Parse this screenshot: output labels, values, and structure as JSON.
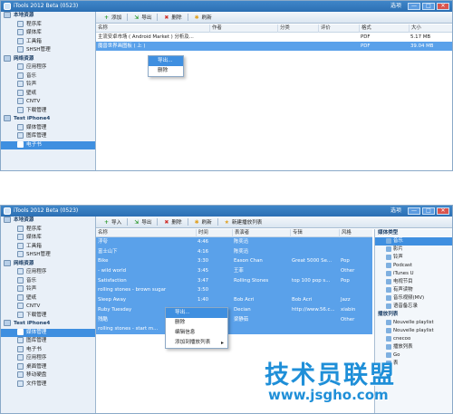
{
  "window1": {
    "title": "iTools 2012 Beta (0523)",
    "options": "选项",
    "window_buttons": [
      "—",
      "□",
      "✕"
    ],
    "sidebar": [
      {
        "type": "group",
        "label": "本地资源",
        "icon": "computer-icon"
      },
      {
        "type": "item",
        "label": "程序库",
        "icon": "app-library-icon"
      },
      {
        "type": "item",
        "label": "媒体库",
        "icon": "media-library-icon"
      },
      {
        "type": "item",
        "label": "工具箱",
        "icon": "toolbox-icon"
      },
      {
        "type": "item",
        "label": "SHSH管理",
        "icon": "shsh-icon"
      },
      {
        "type": "group",
        "label": "网络资源",
        "icon": "globe-icon"
      },
      {
        "type": "item",
        "label": "应用程序",
        "icon": "apps-icon"
      },
      {
        "type": "item",
        "label": "音乐",
        "icon": "music-icon"
      },
      {
        "type": "item",
        "label": "铃声",
        "icon": "ringtone-icon"
      },
      {
        "type": "item",
        "label": "壁纸",
        "icon": "wallpaper-icon"
      },
      {
        "type": "item",
        "label": "CNTV",
        "icon": "tv-icon"
      },
      {
        "type": "item",
        "label": "下载管理",
        "icon": "download-icon"
      },
      {
        "type": "group",
        "label": "Test iPhone4",
        "icon": "iphone-icon"
      },
      {
        "type": "item",
        "label": "媒体管理",
        "icon": "media-manage-icon"
      },
      {
        "type": "item",
        "label": "图库管理",
        "icon": "gallery-icon"
      },
      {
        "type": "item",
        "label": "电子书",
        "icon": "ebook-icon",
        "selected": true
      }
    ],
    "toolbar": [
      {
        "label": "添加",
        "icon": "add-icon",
        "color": "#2e9a2e"
      },
      {
        "label": "导出",
        "icon": "export-icon",
        "color": "#2e9a2e"
      },
      {
        "label": "删除",
        "icon": "delete-icon",
        "color": "#d0302a"
      },
      {
        "label": "刷新",
        "icon": "refresh-icon",
        "color": "#e0a020"
      }
    ],
    "columns": [
      "名称",
      "作者",
      "分类",
      "评价",
      "格式",
      "大小"
    ],
    "rows": [
      {
        "name": "主流安卓市场 ( Android Market ) 分析及...",
        "author": "",
        "category": "",
        "rating": "",
        "format": "PDF",
        "size": "5.17 MB",
        "selected": false
      },
      {
        "name": "魔兽世界画图板 ( 上 )",
        "author": "",
        "category": "",
        "rating": "",
        "format": "PDF",
        "size": "39.04 MB",
        "selected": true
      }
    ],
    "context_menu": [
      "导出...",
      "删除"
    ]
  },
  "window2": {
    "title": "iTools 2012 Beta (0523)",
    "options": "选项",
    "window_buttons": [
      "—",
      "□",
      "✕"
    ],
    "sidebar": [
      {
        "type": "group",
        "label": "本地资源",
        "icon": "computer-icon"
      },
      {
        "type": "item",
        "label": "程序库",
        "icon": "app-library-icon"
      },
      {
        "type": "item",
        "label": "媒体库",
        "icon": "media-library-icon"
      },
      {
        "type": "item",
        "label": "工具箱",
        "icon": "toolbox-icon"
      },
      {
        "type": "item",
        "label": "SHSH管理",
        "icon": "shsh-icon"
      },
      {
        "type": "group",
        "label": "网络资源",
        "icon": "globe-icon"
      },
      {
        "type": "item",
        "label": "应用程序",
        "icon": "apps-icon"
      },
      {
        "type": "item",
        "label": "音乐",
        "icon": "music-icon"
      },
      {
        "type": "item",
        "label": "铃声",
        "icon": "ringtone-icon"
      },
      {
        "type": "item",
        "label": "壁纸",
        "icon": "wallpaper-icon"
      },
      {
        "type": "item",
        "label": "CNTV",
        "icon": "tv-icon"
      },
      {
        "type": "item",
        "label": "下载管理",
        "icon": "download-icon"
      },
      {
        "type": "group",
        "label": "Test iPhone4",
        "icon": "iphone-icon"
      },
      {
        "type": "item",
        "label": "媒体管理",
        "icon": "media-manage-icon",
        "selected": true
      },
      {
        "type": "item",
        "label": "图库管理",
        "icon": "gallery-icon"
      },
      {
        "type": "item",
        "label": "电子书",
        "icon": "ebook-icon"
      },
      {
        "type": "item",
        "label": "应用程序",
        "icon": "apps-icon"
      },
      {
        "type": "item",
        "label": "桌面管理",
        "icon": "desktop-icon"
      },
      {
        "type": "item",
        "label": "移动硬盘",
        "icon": "disk-icon"
      },
      {
        "type": "item",
        "label": "文件管理",
        "icon": "folder-icon"
      }
    ],
    "toolbar": [
      {
        "label": "导入",
        "icon": "import-icon",
        "color": "#2e9a2e"
      },
      {
        "label": "导出",
        "icon": "export-icon",
        "color": "#2e9a2e"
      },
      {
        "label": "删除",
        "icon": "delete-icon",
        "color": "#d0302a"
      },
      {
        "label": "刷新",
        "icon": "refresh-icon",
        "color": "#e0a020"
      },
      {
        "label": "新建播放列表",
        "icon": "new-playlist-icon",
        "color": "#e0a020"
      }
    ],
    "columns": [
      "名称",
      "时间",
      "表演者",
      "专辑",
      "风格"
    ],
    "rows": [
      {
        "name": "浮夸",
        "time": "4:46",
        "artist": "陈奕迅",
        "album": "",
        "genre": ""
      },
      {
        "name": "富士山下",
        "time": "4:16",
        "artist": "陈奕迅",
        "album": "",
        "genre": ""
      },
      {
        "name": "Bike",
        "time": "3:30",
        "artist": "Eason Chan",
        "album": "Great 5000 Se...",
        "genre": "Pop"
      },
      {
        "name": "- wild world",
        "time": "3:45",
        "artist": "王菲",
        "album": "",
        "genre": "Other"
      },
      {
        "name": "Satisfaction",
        "time": "3:47",
        "artist": "Rolling Stones",
        "album": "top 100 pop s...",
        "genre": "Pop"
      },
      {
        "name": "rolling stones - brown sugar",
        "time": "3:50",
        "artist": "",
        "album": "",
        "genre": ""
      },
      {
        "name": "Sleep Away",
        "time": "1:40",
        "artist": "Bob Acri",
        "album": "Bob Acri",
        "genre": "Jazz"
      },
      {
        "name": "Ruby Tuesday",
        "time": "3:16",
        "artist": "Decian",
        "album": "http://www.56.c...",
        "genre": "xiabin"
      },
      {
        "name": "残酷",
        "time": "",
        "artist": "梁静茹",
        "album": "",
        "genre": "Other"
      },
      {
        "name": "rolling stones - start m...",
        "time": "",
        "artist": "",
        "album": "",
        "genre": ""
      }
    ],
    "context_menu": [
      "导出...",
      "删除",
      "编辑信息",
      "添加到播放列表"
    ],
    "right_panel": {
      "media_header": "媒体类型",
      "media_items": [
        {
          "label": "音乐",
          "selected": true
        },
        {
          "label": "影片"
        },
        {
          "label": "铃声"
        },
        {
          "label": "Podcast"
        },
        {
          "label": "iTunes U"
        },
        {
          "label": "电视节目"
        },
        {
          "label": "有声读物"
        },
        {
          "label": "音乐视频(MV)"
        },
        {
          "label": "语音备忘录"
        }
      ],
      "playlist_header": "播放列表",
      "playlist_items": [
        {
          "label": "Nouvelle playlist"
        },
        {
          "label": "Nouvelle playlist"
        },
        {
          "label": "cnecoo"
        },
        {
          "label": "播放列表"
        },
        {
          "label": "Go"
        },
        {
          "label": "表"
        }
      ]
    }
  },
  "watermark": {
    "brand": "技术员联盟",
    "url": "www.jsgho.com"
  }
}
